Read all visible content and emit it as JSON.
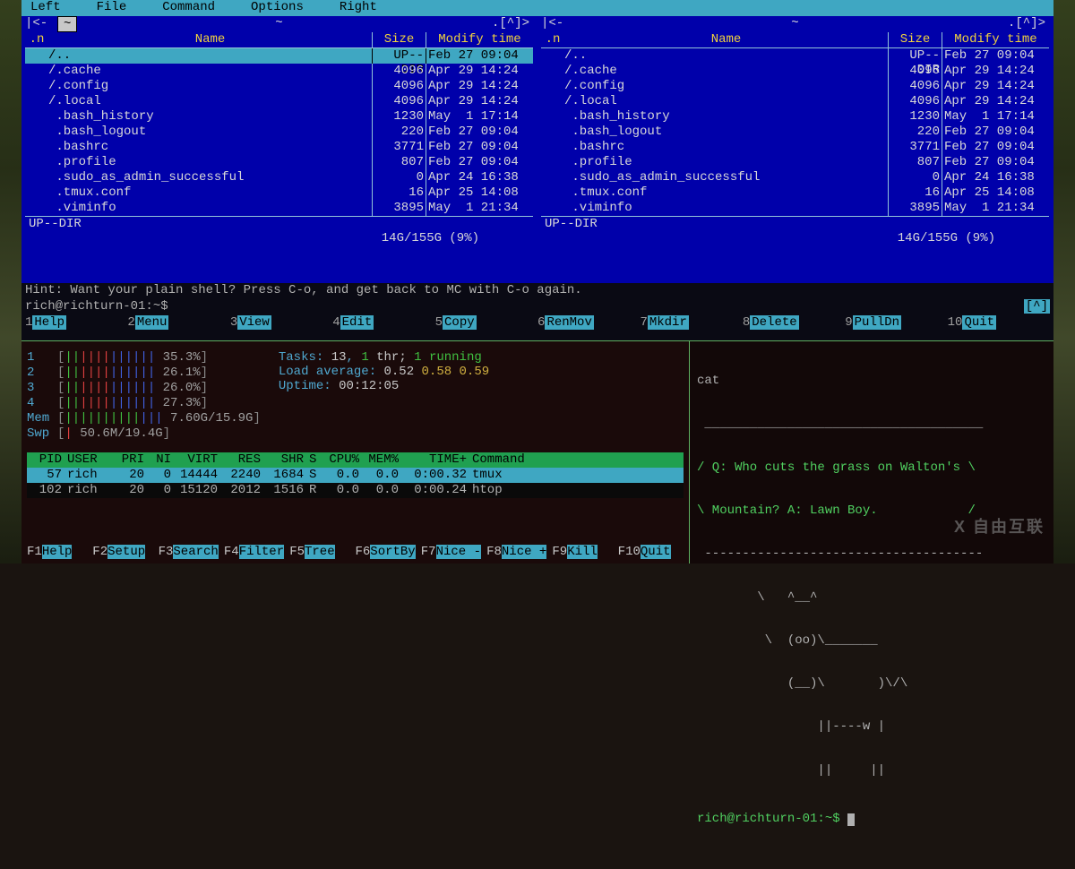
{
  "mc": {
    "menu": [
      "Left",
      "File",
      "Command",
      "Options",
      "Right"
    ],
    "tilde": "~",
    "panel_title_left": "|<-",
    "panel_title_mid": "~",
    "panel_title_right": ".[^]>",
    "header": {
      "n": ".n",
      "name": "Name",
      "size": "Size",
      "mod": "Modify time"
    },
    "rows": [
      {
        "name": "/..",
        "size": "UP--DIR",
        "mod": "Feb 27 09:04",
        "selected": true
      },
      {
        "name": "/.cache",
        "size": "4096",
        "mod": "Apr 29 14:24"
      },
      {
        "name": "/.config",
        "size": "4096",
        "mod": "Apr 29 14:24"
      },
      {
        "name": "/.local",
        "size": "4096",
        "mod": "Apr 29 14:24"
      },
      {
        "name": " .bash_history",
        "size": "1230",
        "mod": "May  1 17:14"
      },
      {
        "name": " .bash_logout",
        "size": "220",
        "mod": "Feb 27 09:04"
      },
      {
        "name": " .bashrc",
        "size": "3771",
        "mod": "Feb 27 09:04"
      },
      {
        "name": " .profile",
        "size": "807",
        "mod": "Feb 27 09:04"
      },
      {
        "name": " .sudo_as_admin_successful",
        "size": "0",
        "mod": "Apr 24 16:38"
      },
      {
        "name": " .tmux.conf",
        "size": "16",
        "mod": "Apr 25 14:08"
      },
      {
        "name": " .viminfo",
        "size": "3895",
        "mod": "May  1 21:34"
      }
    ],
    "footer_updir": "UP--DIR",
    "footer_disk": "14G/155G (9%)",
    "hint": "Hint: Want your plain shell? Press C-o, and get back to MC with C-o again.",
    "prompt": "rich@richturn-01:~$",
    "caret": "[^]",
    "fkeys": [
      {
        "n": "1",
        "l": "Help"
      },
      {
        "n": "2",
        "l": "Menu"
      },
      {
        "n": "3",
        "l": "View"
      },
      {
        "n": "4",
        "l": "Edit"
      },
      {
        "n": "5",
        "l": "Copy"
      },
      {
        "n": "6",
        "l": "RenMov"
      },
      {
        "n": "7",
        "l": "Mkdir"
      },
      {
        "n": "8",
        "l": "Delete"
      },
      {
        "n": "9",
        "l": "PullDn"
      },
      {
        "n": "10",
        "l": "Quit"
      }
    ]
  },
  "htop": {
    "cpus": [
      {
        "label": "1",
        "pct": "35.3%"
      },
      {
        "label": "2",
        "pct": "26.1%"
      },
      {
        "label": "3",
        "pct": "26.0%"
      },
      {
        "label": "4",
        "pct": "27.3%"
      }
    ],
    "mem": {
      "label": "Mem",
      "text": "7.60G/15.9G"
    },
    "swp": {
      "label": "Swp",
      "text": "50.6M/19.4G"
    },
    "tasks_label": "Tasks: ",
    "tasks_a": "13",
    "tasks_b": ", ",
    "tasks_c": "1",
    "tasks_d": " thr; ",
    "tasks_e": "1",
    "tasks_f": " running",
    "load_label": "Load average: ",
    "load_a": "0.52",
    "load_b": "0.58",
    "load_c": "0.59",
    "uptime_label": "Uptime: ",
    "uptime": "00:12:05",
    "head": {
      "pid": "PID",
      "user": "USER",
      "pri": "PRI",
      "ni": "NI",
      "virt": "VIRT",
      "res": "RES",
      "shr": "SHR",
      "s": "S",
      "cpu": "CPU%",
      "mem": "MEM%",
      "time": "TIME+",
      "cmd": "Command"
    },
    "procs": [
      {
        "pid": "57",
        "user": "rich",
        "pri": "20",
        "ni": "0",
        "virt": "14444",
        "res": "2240",
        "shr": "1684",
        "s": "S",
        "cpu": "0.0",
        "mem": "0.0",
        "time": "0:00.32",
        "cmd": "tmux",
        "sel": true
      },
      {
        "pid": "102",
        "user": "rich",
        "pri": "20",
        "ni": "0",
        "virt": "15120",
        "res": "2012",
        "shr": "1516",
        "s": "R",
        "cpu": "0.0",
        "mem": "0.0",
        "time": "0:00.24",
        "cmd": "htop"
      }
    ],
    "fkeys": [
      {
        "n": "F1",
        "l": "Help"
      },
      {
        "n": "F2",
        "l": "Setup"
      },
      {
        "n": "F3",
        "l": "Search"
      },
      {
        "n": "F4",
        "l": "Filter"
      },
      {
        "n": "F5",
        "l": "Tree"
      },
      {
        "n": "F6",
        "l": "SortBy"
      },
      {
        "n": "F7",
        "l": "Nice -"
      },
      {
        "n": "F8",
        "l": "Nice +"
      },
      {
        "n": "F9",
        "l": "Kill"
      },
      {
        "n": "F10",
        "l": "Quit"
      }
    ]
  },
  "rshell": {
    "cat": "cat",
    "line0": " _____________________________________",
    "line1": "/ Q: Who cuts the grass on Walton's \\",
    "line2": "\\ Mountain? A: Lawn Boy.            /",
    "line3": " -------------------------------------",
    "cow1": "        \\   ^__^",
    "cow2": "         \\  (oo)\\_______",
    "cow3": "            (__)\\       )\\/\\",
    "cow4": "                ||----w |",
    "cow5": "                ||     ||",
    "prompt": "rich@richturn-01:~$ "
  },
  "watermark": "X 自由互联"
}
